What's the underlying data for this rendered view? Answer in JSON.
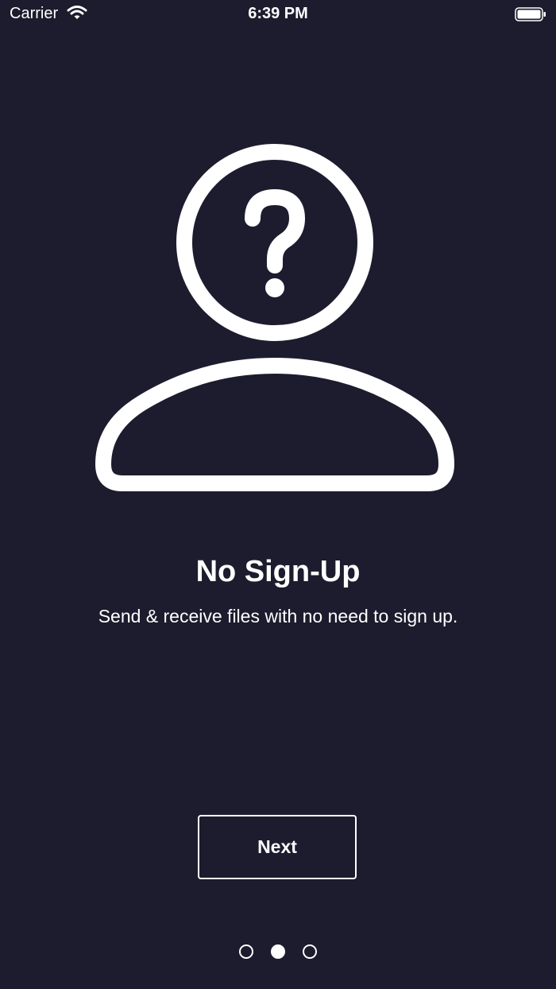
{
  "status_bar": {
    "carrier": "Carrier",
    "time": "6:39 PM",
    "icons": [
      "wifi-icon",
      "battery-icon"
    ]
  },
  "onboarding": {
    "illustration_icon": "person-question-icon",
    "title": "No Sign-Up",
    "subtitle": "Send & receive files with no need to sign up.",
    "next_label": "Next"
  },
  "pager": {
    "pages": 3,
    "active_page": 2
  },
  "colors": {
    "background": "#1c1c2e",
    "foreground": "#ffffff"
  }
}
